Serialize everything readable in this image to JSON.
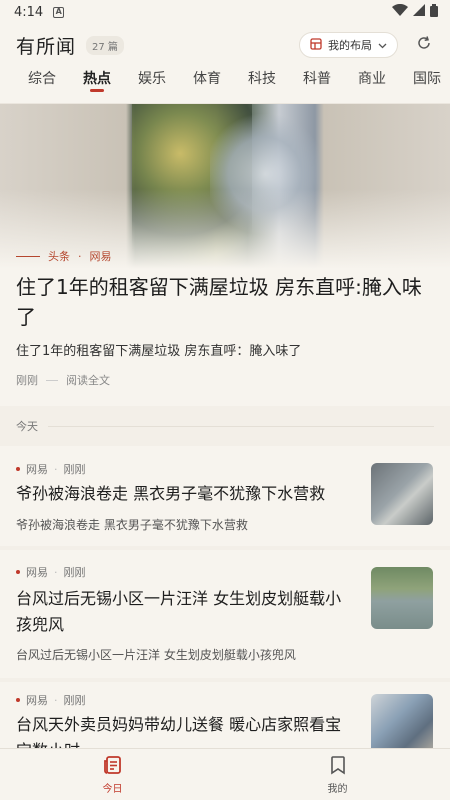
{
  "status": {
    "time": "4:14",
    "notif_letter": "A"
  },
  "header": {
    "title": "有所闻",
    "count": "27 篇",
    "layout_label": "我的布局"
  },
  "tabs": [
    {
      "label": "综合"
    },
    {
      "label": "热点",
      "active": true
    },
    {
      "label": "娱乐"
    },
    {
      "label": "体育"
    },
    {
      "label": "科技"
    },
    {
      "label": "科普"
    },
    {
      "label": "商业"
    },
    {
      "label": "国际"
    }
  ],
  "hero": {
    "category": "头条",
    "source": "网易",
    "title": "住了1年的租客留下满屋垃圾 房东直呼:腌入味了",
    "summary": "住了1年的租客留下满屋垃圾 房东直呼：腌入味了",
    "time": "刚刚",
    "read_full": "阅读全文"
  },
  "section_label": "今天",
  "news": [
    {
      "source": "网易",
      "time": "刚刚",
      "title": "爷孙被海浪卷走 黑衣男子毫不犹豫下水营救",
      "summary": "爷孙被海浪卷走 黑衣男子毫不犹豫下水营救"
    },
    {
      "source": "网易",
      "time": "刚刚",
      "title": "台风过后无锡小区一片汪洋 女生划皮划艇载小孩兜风",
      "summary": "台风过后无锡小区一片汪洋 女生划皮划艇载小孩兜风"
    },
    {
      "source": "网易",
      "time": "刚刚",
      "title": "台风天外卖员妈妈带幼儿送餐 暖心店家照看宝宝数小时",
      "summary": ""
    }
  ],
  "bottom_nav": [
    {
      "label": "今日",
      "icon": "newspaper-icon",
      "active": true
    },
    {
      "label": "我的",
      "icon": "bookmark-icon"
    }
  ],
  "colors": {
    "accent": "#c0392b",
    "background": "#f7f4ee"
  }
}
